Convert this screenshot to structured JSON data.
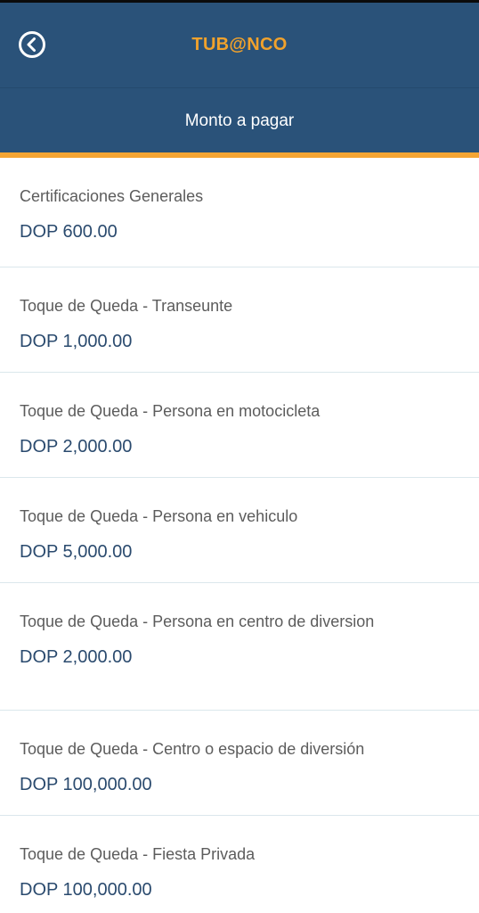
{
  "header": {
    "title": "TUB@NCO",
    "back_icon": "back-circle-icon"
  },
  "subheader": {
    "title": "Monto a pagar"
  },
  "colors": {
    "primary": "#2a5279",
    "accent": "#f5a533",
    "title_accent": "#f1a22c",
    "amount_text": "#2a4a6e"
  },
  "items": [
    {
      "label": "Certificaciones Generales",
      "amount": "DOP 600.00"
    },
    {
      "label": "Toque de Queda - Transeunte",
      "amount": "DOP 1,000.00"
    },
    {
      "label": "Toque de Queda - Persona en motocicleta",
      "amount": "DOP 2,000.00"
    },
    {
      "label": "Toque de Queda -  Persona en vehiculo",
      "amount": "DOP 5,000.00"
    },
    {
      "label": "Toque de Queda -  Persona en centro de diversion",
      "amount": "DOP 2,000.00"
    },
    {
      "label": "Toque de Queda - Centro o espacio de diversión",
      "amount": "DOP 100,000.00"
    },
    {
      "label": "Toque de Queda - Fiesta Privada",
      "amount": "DOP 100,000.00"
    }
  ]
}
